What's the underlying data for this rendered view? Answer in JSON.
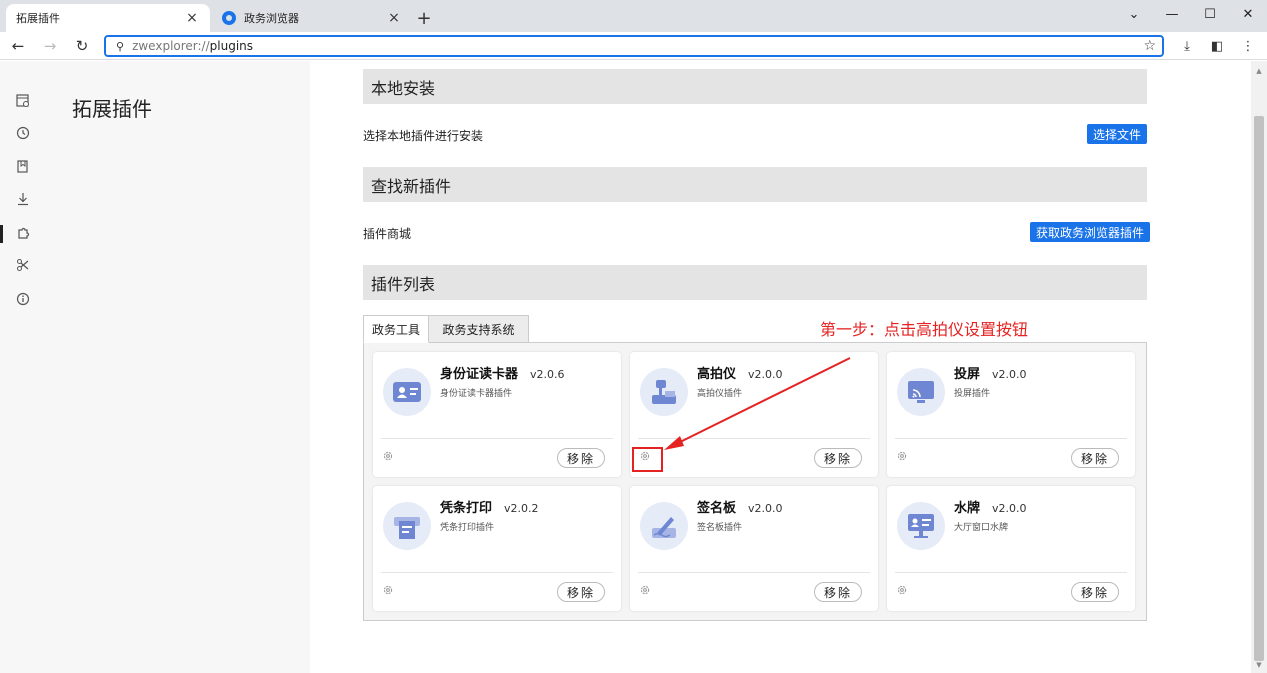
{
  "browser": {
    "tabs": [
      {
        "label": "拓展插件",
        "active": true
      },
      {
        "label": "政务浏览器",
        "active": false
      }
    ],
    "new_tab": "+",
    "url_scheme": "zwexplorer://",
    "url_path": "plugins",
    "window_controls": [
      "⌄",
      "—",
      "☐",
      "✕"
    ],
    "accent_color": "#1a73e8"
  },
  "rail_icons": [
    "browser-settings-icon",
    "history-icon",
    "bookmarks-icon",
    "download-icon",
    "extensions-icon",
    "tools-icon",
    "about-icon"
  ],
  "page": {
    "title": "拓展插件",
    "sections": {
      "local_install": {
        "header": "本地安装",
        "row_label": "选择本地插件进行安装",
        "button": "选择文件"
      },
      "find_new": {
        "header": "查找新插件",
        "row_label": "插件商城",
        "button": "获取政务浏览器插件"
      },
      "plugin_list": {
        "header": "插件列表",
        "tabs": [
          "政务工具",
          "政务支持系统"
        ],
        "active_tab": "政务工具",
        "remove_label": "移除",
        "plugins": [
          {
            "name": "身份证读卡器",
            "version": "v2.0.6",
            "desc": "身份证读卡器插件",
            "icon": "id-card-icon"
          },
          {
            "name": "高拍仪",
            "version": "v2.0.0",
            "desc": "高拍仪插件",
            "icon": "document-camera-icon"
          },
          {
            "name": "投屏",
            "version": "v2.0.0",
            "desc": "投屏插件",
            "icon": "screen-cast-icon"
          },
          {
            "name": "凭条打印",
            "version": "v2.0.2",
            "desc": "凭条打印插件",
            "icon": "receipt-printer-icon"
          },
          {
            "name": "签名板",
            "version": "v2.0.0",
            "desc": "签名板插件",
            "icon": "signature-pad-icon"
          },
          {
            "name": "水牌",
            "version": "v2.0.0",
            "desc": "大厅窗口水牌",
            "icon": "nameplate-icon"
          }
        ]
      }
    }
  },
  "annotation": {
    "text": "第一步：点击高拍仪设置按钮",
    "color": "#e52222"
  }
}
